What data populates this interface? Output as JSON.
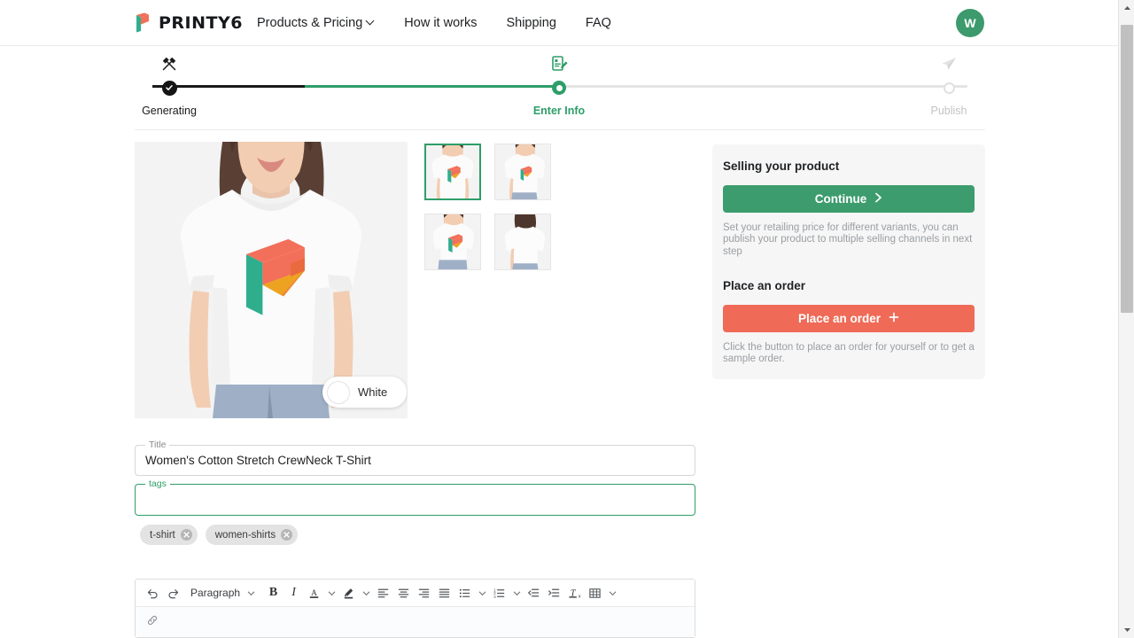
{
  "header": {
    "brand_name": "PRINTY6",
    "nav": [
      {
        "label": "Products & Pricing",
        "has_dropdown": true
      },
      {
        "label": "How it works",
        "has_dropdown": false
      },
      {
        "label": "Shipping",
        "has_dropdown": false
      },
      {
        "label": "FAQ",
        "has_dropdown": false
      }
    ],
    "avatar_initial": "W",
    "avatar_color": "#3c9a6d"
  },
  "stepper": {
    "steps": [
      {
        "label": "Generating",
        "state": "done",
        "icon": "design-tools-icon"
      },
      {
        "label": "Enter Info",
        "state": "active",
        "icon": "document-edit-icon"
      },
      {
        "label": "Publish",
        "state": "idle",
        "icon": "paper-plane-icon"
      }
    ],
    "active_color": "#2e9e68",
    "done_color": "#151515",
    "idle_color": "#c3c3c3"
  },
  "product": {
    "main_image_alt": "Woman wearing white t-shirt with colorful P logo",
    "color_swatch": {
      "label": "White",
      "hex": "#ffffff"
    },
    "thumbnails": [
      {
        "alt": "front view selected",
        "selected": true
      },
      {
        "alt": "three quarter view",
        "selected": false
      },
      {
        "alt": "closer front view",
        "selected": false
      },
      {
        "alt": "back view",
        "selected": false
      }
    ]
  },
  "form": {
    "title_field": {
      "label": "Title",
      "value": "Women's Cotton Stretch CrewNeck T-Shirt",
      "placeholder": "",
      "focused": false
    },
    "tags_field": {
      "label": "tags",
      "value": "",
      "placeholder": "",
      "focused": true
    },
    "tags": [
      {
        "label": "t-shirt"
      },
      {
        "label": "women-shirts"
      }
    ]
  },
  "editor": {
    "block_format": "Paragraph",
    "tools": [
      {
        "name": "undo-icon"
      },
      {
        "name": "redo-icon"
      },
      {
        "name": "bold-icon"
      },
      {
        "name": "italic-icon"
      },
      {
        "name": "text-color-icon"
      },
      {
        "name": "highlight-color-icon"
      },
      {
        "name": "align-left-icon"
      },
      {
        "name": "align-center-icon"
      },
      {
        "name": "align-right-icon"
      },
      {
        "name": "align-justify-icon"
      },
      {
        "name": "bullet-list-icon"
      },
      {
        "name": "numbered-list-icon"
      },
      {
        "name": "outdent-icon"
      },
      {
        "name": "indent-icon"
      },
      {
        "name": "clear-formatting-icon"
      },
      {
        "name": "table-icon"
      }
    ],
    "body_text": ""
  },
  "sidebar": {
    "selling_card": {
      "title": "Selling your product",
      "button_label": "Continue",
      "button_color": "#3d9c6d",
      "note": "Set your retailing price for different variants, you can publish your product to multiple selling channels in next step"
    },
    "order_card": {
      "title": "Place an order",
      "button_label": "Place an order",
      "button_color": "#ef6a57",
      "note": "Click the button to place an order for yourself or to get a sample order."
    }
  }
}
